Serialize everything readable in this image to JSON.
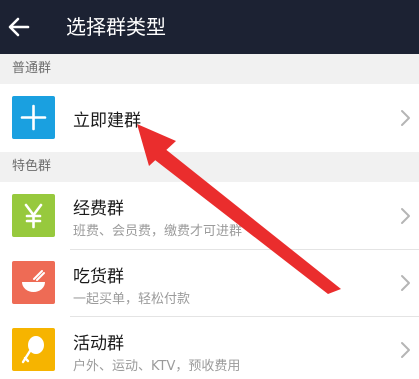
{
  "titlebar": {
    "title": "选择群类型",
    "back_icon": "back-arrow-icon"
  },
  "sections": {
    "normal": "普通群",
    "special": "特色群"
  },
  "rows": [
    {
      "label": "立即建群",
      "desc": "",
      "icon": "plus-icon",
      "color": "#1aa0e0"
    },
    {
      "label": "经费群",
      "desc": "班费、会员费，缴费才可进群",
      "icon": "yen-icon",
      "color": "#97c93d"
    },
    {
      "label": "吃货群",
      "desc": "一起买单，轻松付款",
      "icon": "food-bowl-icon",
      "color": "#ee6b55"
    },
    {
      "label": "活动群",
      "desc": "户外、运动、KTV，预收费用",
      "icon": "balloon-icon",
      "color": "#f6b400"
    }
  ],
  "colors": {
    "titlebar_bg": "#1c2233",
    "section_bg": "#f1f1f1",
    "annotation": "#ea2d2d"
  }
}
